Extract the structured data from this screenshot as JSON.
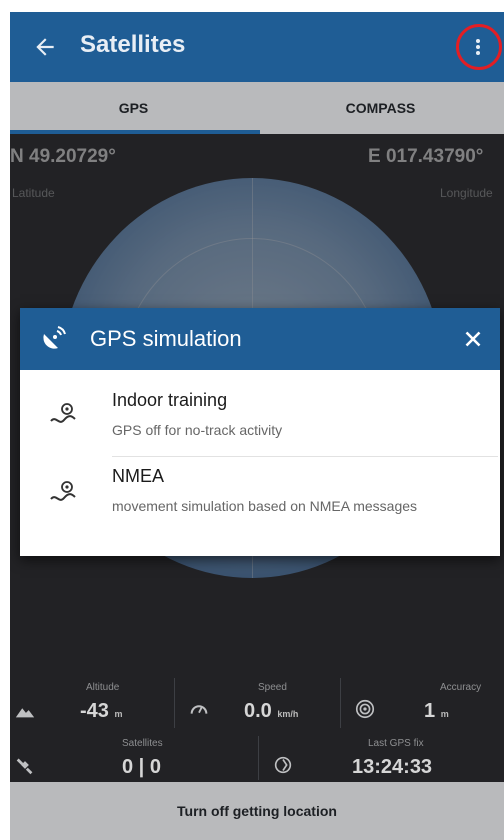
{
  "appbar": {
    "title": "Satellites"
  },
  "tabs": [
    {
      "label": "GPS"
    },
    {
      "label": "COMPASS"
    }
  ],
  "coords": {
    "latitude": {
      "value": "N 49.20729°",
      "label": "Latitude"
    },
    "longitude": {
      "value": "E 017.43790°",
      "label": "Longitude"
    }
  },
  "dialog": {
    "title": "GPS simulation",
    "items": [
      {
        "title": "Indoor training",
        "subtitle": "GPS off for no-track activity"
      },
      {
        "title": "NMEA",
        "subtitle": "movement simulation based on NMEA messages"
      }
    ]
  },
  "stats": {
    "altitude": {
      "label": "Altitude",
      "value": "-43",
      "unit": "m"
    },
    "speed": {
      "label": "Speed",
      "value": "0.0",
      "unit": "km/h"
    },
    "accuracy": {
      "label": "Accuracy",
      "value": "1",
      "unit": "m"
    },
    "satellites": {
      "label": "Satellites",
      "value": "0 | 0"
    },
    "last_fix": {
      "label": "Last GPS fix",
      "value": "13:24:33"
    }
  },
  "bottom_button": {
    "label": "Turn off getting location"
  },
  "colors": {
    "primary": "#1f5d95",
    "highlight": "#e31e24",
    "background": "#2e2f32"
  }
}
